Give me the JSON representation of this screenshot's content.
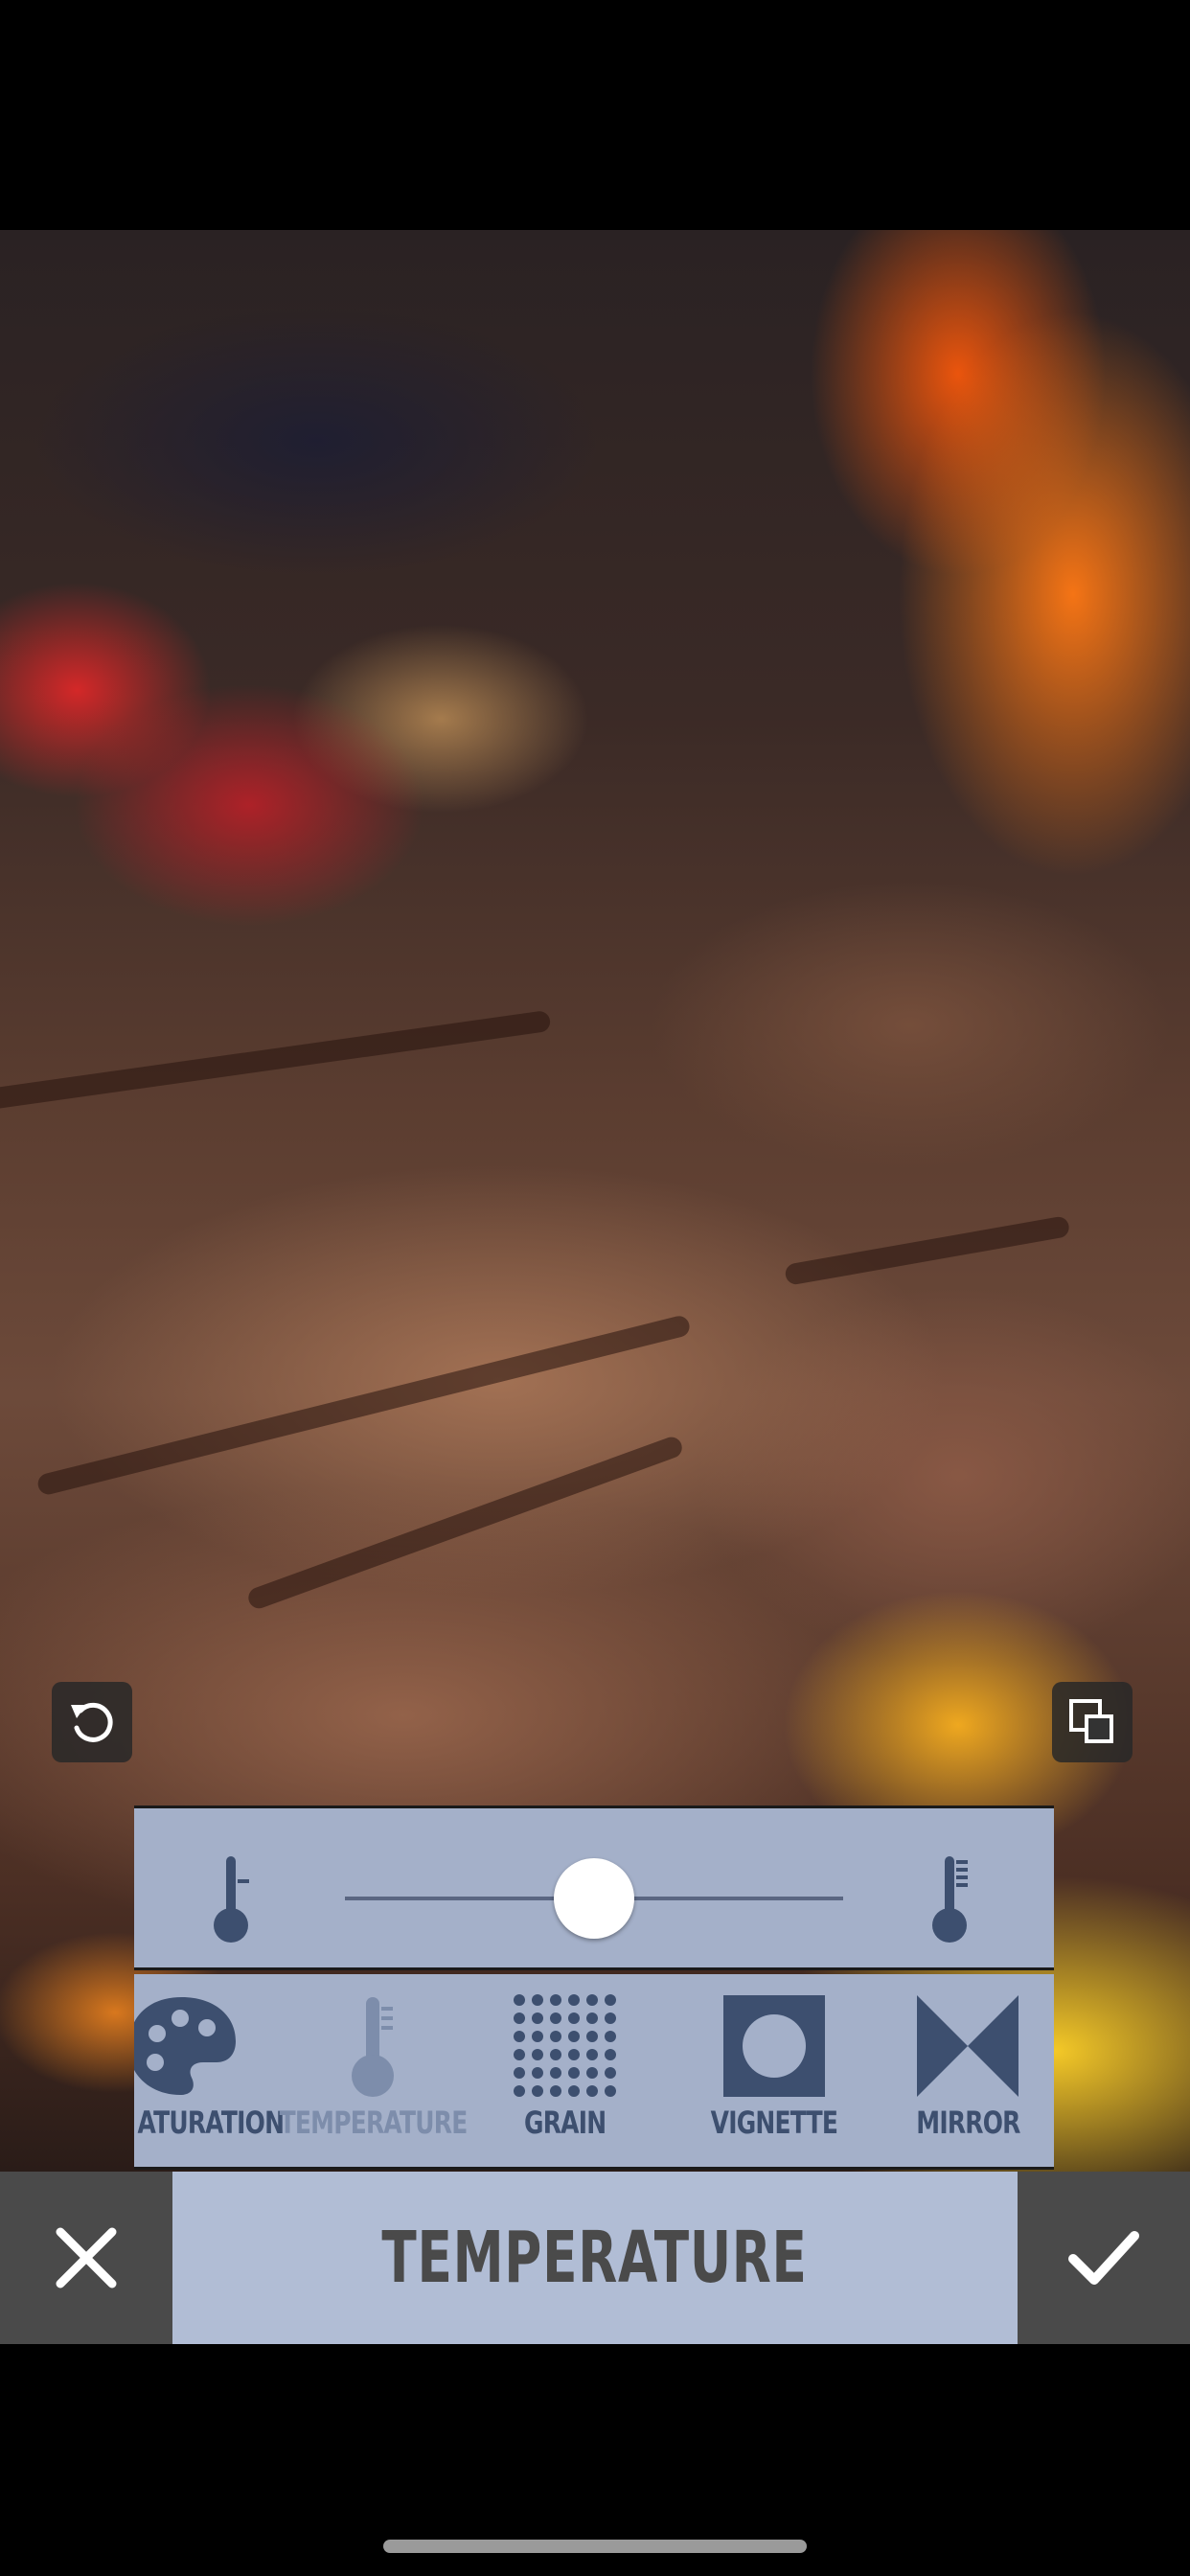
{
  "editor": {
    "mode_title": "TEMPERATURE",
    "tools": [
      {
        "label": "SATURATION",
        "visible_label": "ATURATION",
        "icon": "palette-icon"
      },
      {
        "label": "TEMPERATURE",
        "icon": "thermometer-icon",
        "active": true
      },
      {
        "label": "GRAIN",
        "icon": "grain-dots-icon"
      },
      {
        "label": "VIGNETTE",
        "icon": "vignette-icon"
      },
      {
        "label": "MIRROR",
        "icon": "mirror-icon"
      }
    ],
    "slider": {
      "value_fraction": 0.5,
      "min_icon": "thermometer-cold-icon",
      "max_icon": "thermometer-hot-icon"
    },
    "photo_buttons": {
      "left": "reset-icon",
      "right": "compare-icon"
    },
    "actions": {
      "cancel": "close-icon",
      "confirm": "checkmark-icon"
    }
  },
  "colors": {
    "panel": "#a4b0c9",
    "title_box": "#b1bdd5",
    "icon_dark": "#3d4f6f",
    "icon_active": "#7d8dab",
    "action_bg": "#4a4a4a"
  }
}
